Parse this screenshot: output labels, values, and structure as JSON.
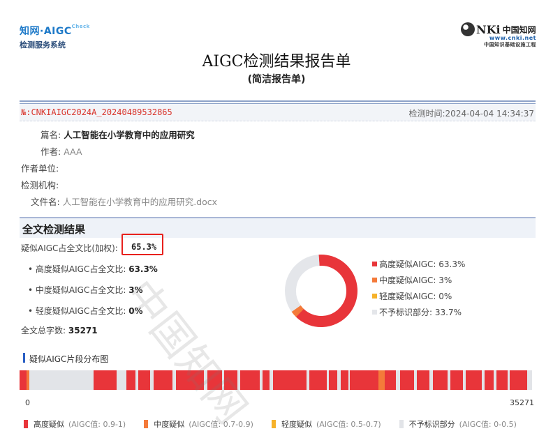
{
  "brand_left": {
    "line1": "知网·AIGC",
    "line1_sup": "Check",
    "line2": "检测服务系统"
  },
  "brand_right": {
    "mark": "NKi",
    "cn": "中国知网",
    "url": "www.cnki.net",
    "project": "中国知识基础设施工程"
  },
  "title": "AIGC检测结果报告单",
  "subtitle": "(简洁报告单)",
  "report_no": "№:CNKIAIGC2024A_20240489532865",
  "detect_time": "检测时间:2024-04-04 14:34:37",
  "meta": {
    "title_label": "篇名:",
    "title_value": "人工智能在小学教育中的应用研究",
    "author_label": "作者:",
    "author_value": "AAA",
    "unit_label": "作者单位:",
    "unit_value": "",
    "org_label": "检测机构:",
    "org_value": "",
    "file_label": "文件名:",
    "file_value": "人工智能在小学教育中的应用研究.docx"
  },
  "section_title": "全文检测结果",
  "results": {
    "weighted_label": "疑似AIGC占全文比(加权):",
    "weighted_value": "65.3%",
    "high_label": "• 高度疑似AIGC占全文比:",
    "high_value": "63.3%",
    "mid_label": "• 中度疑似AIGC占全文比:",
    "mid_value": "3%",
    "low_label": "• 轻度疑似AIGC占全文比:",
    "low_value": "0%",
    "total_label": "全文总字数:",
    "total_value": "35271"
  },
  "chart_data": {
    "type": "pie",
    "donut": true,
    "categories": [
      "高度疑似AIGC",
      "中度疑似AIGC",
      "轻度疑似AIGC",
      "不予标识部分"
    ],
    "values": [
      63.3,
      3,
      0,
      33.7
    ],
    "colors": [
      "#e8353a",
      "#f47a3a",
      "#f6b22a",
      "#e4e6ea"
    ],
    "legend": [
      "高度疑似AIGC: 63.3%",
      "中度疑似AIGC: 3%",
      "轻度疑似AIGC: 0%",
      "不予标识部分: 33.7%"
    ],
    "legend_position": "right"
  },
  "distribution": {
    "title": "疑似AIGC片段分布图",
    "min_label": "0",
    "max_label": "35271",
    "segments": [
      {
        "start": 0.0,
        "end": 0.014,
        "level": "high"
      },
      {
        "start": 0.014,
        "end": 0.019,
        "level": "mid"
      },
      {
        "start": 0.145,
        "end": 0.19,
        "level": "high"
      },
      {
        "start": 0.208,
        "end": 0.226,
        "level": "high"
      },
      {
        "start": 0.232,
        "end": 0.255,
        "level": "high"
      },
      {
        "start": 0.261,
        "end": 0.298,
        "level": "high"
      },
      {
        "start": 0.305,
        "end": 0.36,
        "level": "high"
      },
      {
        "start": 0.366,
        "end": 0.395,
        "level": "high"
      },
      {
        "start": 0.399,
        "end": 0.425,
        "level": "high"
      },
      {
        "start": 0.43,
        "end": 0.469,
        "level": "high"
      },
      {
        "start": 0.474,
        "end": 0.488,
        "level": "high"
      },
      {
        "start": 0.495,
        "end": 0.56,
        "level": "high"
      },
      {
        "start": 0.566,
        "end": 0.6,
        "level": "high"
      },
      {
        "start": 0.603,
        "end": 0.62,
        "level": "high"
      },
      {
        "start": 0.627,
        "end": 0.642,
        "level": "high"
      },
      {
        "start": 0.645,
        "end": 0.7,
        "level": "high"
      },
      {
        "start": 0.7,
        "end": 0.712,
        "level": "mid"
      },
      {
        "start": 0.712,
        "end": 0.735,
        "level": "high"
      },
      {
        "start": 0.742,
        "end": 0.77,
        "level": "high"
      },
      {
        "start": 0.775,
        "end": 0.8,
        "level": "high"
      },
      {
        "start": 0.807,
        "end": 0.835,
        "level": "high"
      },
      {
        "start": 0.84,
        "end": 0.865,
        "level": "high"
      },
      {
        "start": 0.87,
        "end": 0.902,
        "level": "high"
      },
      {
        "start": 0.908,
        "end": 0.925,
        "level": "high"
      },
      {
        "start": 0.93,
        "end": 0.952,
        "level": "high"
      },
      {
        "start": 0.956,
        "end": 0.99,
        "level": "high"
      }
    ],
    "colors": {
      "high": "#e8353a",
      "mid": "#f47a3a",
      "low": "#f6b22a",
      "none": "#e2e4e8"
    }
  },
  "bottom_legend": [
    {
      "label": "高度疑似",
      "note": "(AIGC值: 0.9-1)",
      "color": "#e8353a"
    },
    {
      "label": "中度疑似",
      "note": "(AIGC值: 0.7-0.9)",
      "color": "#f47a3a"
    },
    {
      "label": "轻度疑似",
      "note": "(AIGC值: 0.5-0.7)",
      "color": "#f6b22a"
    },
    {
      "label": "不予标识部分",
      "note": "(AIGC值: 0-0.5)",
      "color": "#e2e4e8"
    }
  ],
  "watermark": "中国知网"
}
